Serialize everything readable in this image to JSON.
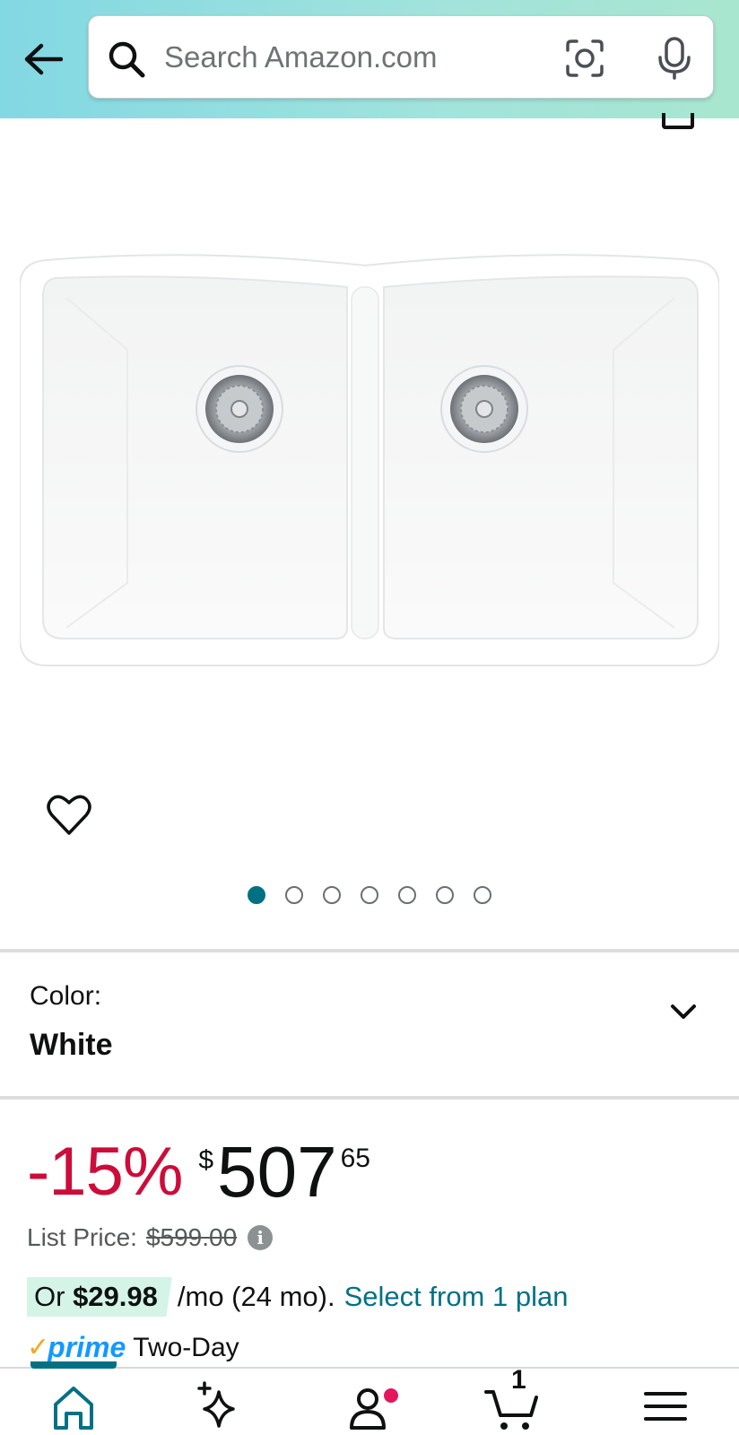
{
  "search": {
    "placeholder": "Search Amazon.com"
  },
  "icons": {
    "back": "arrow-left-icon",
    "search": "search-icon",
    "camera": "camera-lens-icon",
    "mic": "microphone-icon",
    "wishlist": "heart-icon",
    "info": "info-icon",
    "chevron": "chevron-down-icon"
  },
  "gallery": {
    "total_images": 7,
    "active_index": 0
  },
  "variation": {
    "label": "Color:",
    "value": "White"
  },
  "price": {
    "discount": "-15%",
    "symbol": "$",
    "whole": "507",
    "fraction": "65",
    "list_label": "List Price:",
    "list_value": "$599.00"
  },
  "installment": {
    "prefix": "Or ",
    "amount": "$29.98",
    "term": "/mo (24 mo).",
    "link": "Select from 1 plan"
  },
  "prime": {
    "check": "✓",
    "word": "prime",
    "delivery": "Two-Day"
  },
  "bottom_nav": {
    "cart_count": "1"
  },
  "colors": {
    "accent": "#007185",
    "discount_red": "#cc0c39",
    "prime_blue": "#1399ff",
    "prime_orange": "#f7a41d",
    "badge_green": "#d5f4e8"
  }
}
